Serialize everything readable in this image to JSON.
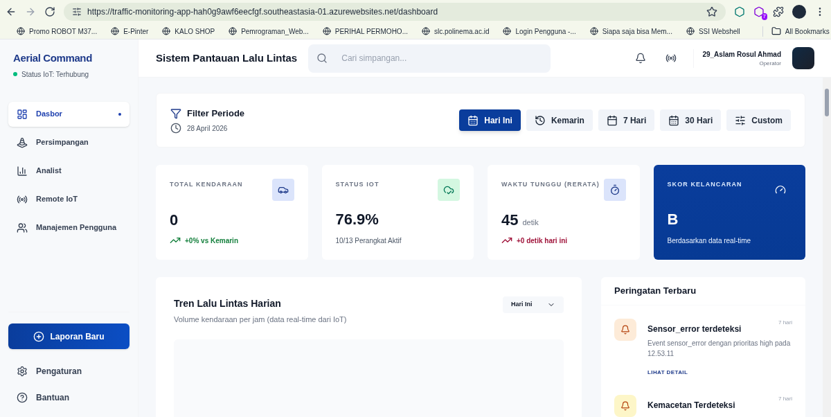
{
  "browser": {
    "url": "https://traffic-monitoring-app-hah0g9awf6eecfgf.southeastasia-01.azurewebsites.net/dashboard",
    "extension_badge": "7",
    "bookmarks": [
      "Promo ROBOT M37...",
      "E-Pinter",
      "KALO SHOP",
      "Pemrograman_Web...",
      "PERIHAL PERMOHO...",
      "slc.polinema.ac.id",
      "Login Pengguna -...",
      "Siapa saja bisa Mem...",
      "SSI Webshell"
    ],
    "all_bookmarks": "All Bookmarks"
  },
  "sidebar": {
    "brand": "Aerial Command",
    "status": {
      "text": "Status IoT: Terhubung",
      "connected": true
    },
    "items": [
      {
        "label": "Dasbor",
        "selected": true
      },
      {
        "label": "Persimpangan",
        "selected": false
      },
      {
        "label": "Analist",
        "selected": false
      },
      {
        "label": "Remote IoT",
        "selected": false
      },
      {
        "label": "Manajemen Pengguna",
        "selected": false
      }
    ],
    "new_report": "Laporan Baru",
    "footer": [
      "Pengaturan",
      "Bantuan"
    ]
  },
  "header": {
    "title": "Sistem Pantauan Lalu Lintas",
    "search_placeholder": "Cari simpangan...",
    "user": "29_Aslam Rosul Ahmad",
    "role": "Operator"
  },
  "filter": {
    "title": "Filter Periode",
    "date": "28 April 2026",
    "periods": [
      {
        "label": "Hari Ini",
        "selected": true
      },
      {
        "label": "Kemarin",
        "selected": false
      },
      {
        "label": "7 Hari",
        "selected": false
      },
      {
        "label": "30 Hari",
        "selected": false
      },
      {
        "label": "Custom",
        "selected": false
      }
    ]
  },
  "stats": [
    {
      "kind": "metric",
      "label": "TOTAL KENDARAAN",
      "value": "0",
      "change": "+0% vs Kemarin",
      "color": "#15803d"
    },
    {
      "kind": "metric",
      "label": "STATUS IOT",
      "value": "76.9%",
      "note": "10/13 Perangkat Aktif"
    },
    {
      "kind": "metric",
      "label": "WAKTU TUNGGU (RERATA)",
      "value": "45",
      "unit": "detik",
      "change": "+0 detik hari ini",
      "color": "#9f1239"
    },
    {
      "kind": "score",
      "label": "SKOR KELANCARAN",
      "value": "B",
      "note": "Berdasarkan data real-time"
    }
  ],
  "chart": {
    "title": "Tren Lalu Lintas Harian",
    "subtitle": "Volume kendaraan per jam (data real-time dari IoT)",
    "range": "Hari Ini"
  },
  "alerts": {
    "title": "Peringatan Terbaru",
    "items": [
      {
        "title": "Sensor_error terdeteksi",
        "description": "Event sensor_error dengan prioritas high pada 12.53.11",
        "time": "7 hari",
        "link": "LIHAT DETAIL",
        "color": "#fdebd8"
      },
      {
        "title": "Kemacetan Terdeteksi",
        "time": "7 hari",
        "color": "#fdf6c8"
      }
    ]
  }
}
